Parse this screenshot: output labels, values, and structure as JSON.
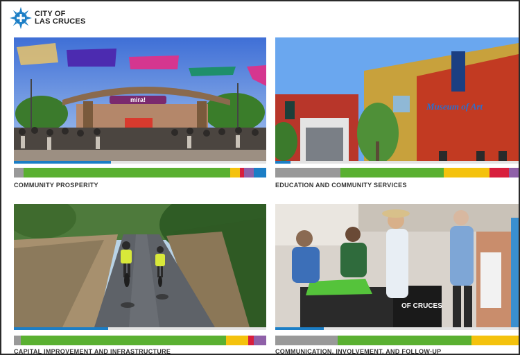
{
  "header": {
    "logo_line1": "CITY OF",
    "logo_line2": "LAS CRUCES"
  },
  "cards": [
    {
      "caption": "COMMUNITY PROSPERITY",
      "image_label": "mira!",
      "stripe": [
        "#999999",
        "#5ab031",
        "#f4c20d",
        "#d81f3d",
        "#8f60a8",
        "#1b7ec6"
      ]
    },
    {
      "caption": "EDUCATION AND COMMUNITY SERVICES",
      "image_label": "Museum of Art",
      "stripe": [
        "#999999",
        "#5ab031",
        "#f4c20d",
        "#d81f3d",
        "#8f60a8"
      ]
    },
    {
      "caption": "CAPITAL IMPROVEMENT AND INFRASTRUCTURE",
      "stripe": [
        "#999999",
        "#5ab031",
        "#f4c20d",
        "#d81f3d",
        "#8f60a8"
      ]
    },
    {
      "caption": "COMMUNICATION, INVOLVEMENT, AND FOLLOW-UP",
      "image_label": "OF CRUCES",
      "stripe": [
        "#999999",
        "#5ab031",
        "#f4c20d"
      ]
    }
  ]
}
